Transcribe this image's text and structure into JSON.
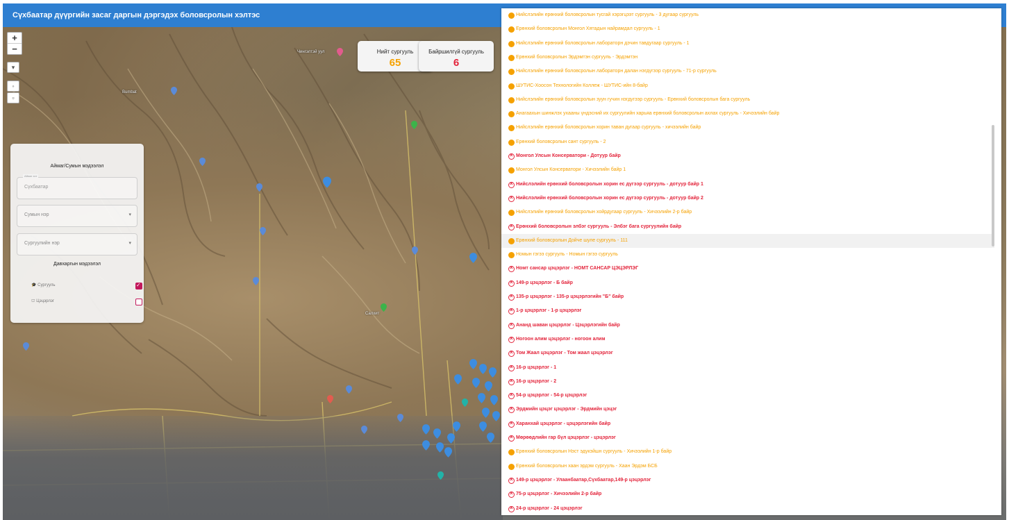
{
  "header": {
    "title": "Сүхбаатар дүүргийн засаг даргын дэргэдэх боловсролын хэлтэс"
  },
  "map": {
    "zoom_in": "+",
    "zoom_out": "−",
    "labels": [
      "Чингэлтэй уул",
      "Bumbat",
      "Салхит"
    ]
  },
  "stats": {
    "total": {
      "label": "Нийт сургууль",
      "value": "65",
      "color": "#f5a100"
    },
    "no_building": {
      "label": "Байршилгүй сургууль",
      "value": "6",
      "color": "#e3243b"
    }
  },
  "filter": {
    "title": "Аймаг/Сумын мэдээлэл",
    "aimag_legend": "Аймаг хот",
    "aimag_value": "Сүхбаатар",
    "sum_placeholder": "Сумын нэр",
    "school_placeholder": "Сургуулийн нэр",
    "layers_title": "Давхаргын мэдээлэл",
    "layers": [
      {
        "label": "Сургууль",
        "checked": true
      },
      {
        "label": "Цэцэрлэг",
        "checked": false
      }
    ]
  },
  "list": [
    {
      "text": "Нийслэлийн ерөнхий боловсролын тусгай хэрэгцээт сургууль - 3 дугаар сургууль",
      "status": "orange"
    },
    {
      "text": "Ерөнхий боловсролын Монгол Хятадын найрамдал сургууль - 1",
      "status": "orange"
    },
    {
      "text": "Нийслэлийн ерөнхий боловсролын лабораторн дэчин тавдугаар сургууль - 1",
      "status": "orange"
    },
    {
      "text": "Ерөнхий боловсролын Эрдэмтэн сургууль - Эрдэмтэн",
      "status": "orange"
    },
    {
      "text": "Нийслэлийн ерөнхий боловсролын лабораторн далан нэгдүгээр сургууль - 71-р сургууль",
      "status": "orange"
    },
    {
      "text": "ШУТИС-Хоосон Технологийн Коллеж - ШУТИС-ийн 8-байр",
      "status": "orange"
    },
    {
      "text": "Нийслэлийн ерөнхий боловсролын зуун гучин нэгдүгээр сургууль - Ерөнхий боловсролын бага сургууль",
      "status": "orange"
    },
    {
      "text": "Анагаахын шинжлэх ухааны үндэсний их сургуулийн харьяа ерөнхий боловсролын ахлах сургууль - Хичээлийн байр",
      "status": "orange"
    },
    {
      "text": "Нийслэлийн ерөнхий боловсролын хорин таван дугаар сургууль - хичээлийн байр",
      "status": "orange"
    },
    {
      "text": "Ерөнхий боловсролын сант сургууль - 2",
      "status": "orange"
    },
    {
      "text": "Монгол Улсын Консерватори - Дотуур байр",
      "status": "red"
    },
    {
      "text": "Монгол Улсын Консерватори - Хичээлийн байр 1",
      "status": "orange"
    },
    {
      "text": "Нийслэлийн ерөнхий боловсролын хорин ес дүгээр сургууль - дотуур байр 1",
      "status": "red"
    },
    {
      "text": "Нийслэлийн ерөнхий боловсролын хорин ес дүгээр сургууль - дотуур байр 2",
      "status": "red"
    },
    {
      "text": "Нийслэлийн ерөнхий боловсролын хойрдугаар сургууль - Хичээлийн 2-р байр",
      "status": "orange"
    },
    {
      "text": "Ерөнхий боловсролын элбэг сургууль - Элбэг бага сургуулийн байр",
      "status": "red"
    },
    {
      "text": "Ерөнхий боловсролын Дойче шуле сургууль - 111",
      "status": "orange",
      "highlight": true
    },
    {
      "text": "Номын гэгээ сургууль - Номын гэгээ сургууль",
      "status": "orange"
    },
    {
      "text": "Номт сансар цэцэрлэг - НОМТ САНСАР ЦЭЦЭРЛЭГ",
      "status": "red"
    },
    {
      "text": "149-р цэцэрлэг - Б байр",
      "status": "red"
    },
    {
      "text": "135-р цэцэрлэг - 135-р цэцэрлэгийн \"Б\" байр",
      "status": "red"
    },
    {
      "text": "1-р цэцэрлэг - 1-р цэцэрлэг",
      "status": "red"
    },
    {
      "text": "Ананд шаван цэцэрлэг - Цэцэрлэгийн байр",
      "status": "red"
    },
    {
      "text": "Ногоон алим цэцэрлэг - ногоон алим",
      "status": "red"
    },
    {
      "text": "Том Жаал цэцэрлэг - Том жаал цэцэрлэг",
      "status": "red"
    },
    {
      "text": "16-р цэцэрлэг - 1",
      "status": "red"
    },
    {
      "text": "16-р цэцэрлэг - 2",
      "status": "red"
    },
    {
      "text": "54-р цэцэрлэг - 54-р цэцэрлэг",
      "status": "red"
    },
    {
      "text": "Эрдмийн цэцэг цэцэрлэг - Эрдмийн цэцэг",
      "status": "red"
    },
    {
      "text": "Харанхай цэцэрлэг - цэцэрлэгийн байр",
      "status": "red"
    },
    {
      "text": "Мөрөөдлийн гар бүл цэцэрлэг - цэцэрлэг",
      "status": "red"
    },
    {
      "text": "Ерөнхий боловсролын Нэст эдүкэйшн сургууль - Хичээлийн 1-р байр",
      "status": "orange"
    },
    {
      "text": "Ерөнхий боловсролын хаан эрдэм сургууль - Хаан Эрдэм БСБ",
      "status": "orange"
    },
    {
      "text": "149-р цэцэрлэг - Улаанбаатар,Сүхбаатар,149-р цэцэрлэг",
      "status": "red"
    },
    {
      "text": "75-р цэцэрлэг - Хичээлийн 2-р байр",
      "status": "red"
    },
    {
      "text": "24-р цэцэрлэг - 24 цэцэрлэг",
      "status": "red"
    }
  ]
}
